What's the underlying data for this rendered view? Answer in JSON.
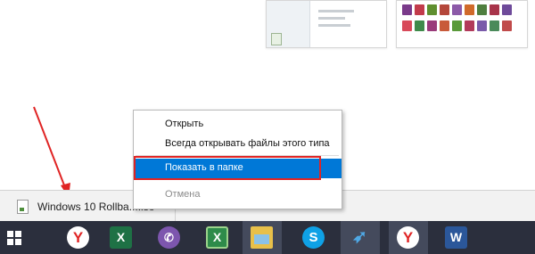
{
  "download_bar": {
    "filename": "Windows 10 Rollba....iso",
    "close_symbol": "×"
  },
  "context_menu": {
    "open": "Открыть",
    "always_open": "Всегда открывать файлы этого типа",
    "show_in_folder": "Показать в папке",
    "cancel": "Отмена",
    "selected_color": "#0078d7"
  },
  "annotation": {
    "color": "#e02424"
  },
  "taskbar": {
    "items": [
      {
        "icon": "windows-start-icon"
      },
      {
        "icon": "yandex-browser-icon",
        "glyph": "Y"
      },
      {
        "icon": "excel-icon",
        "glyph": "X"
      },
      {
        "icon": "viber-icon",
        "glyph": "✆"
      },
      {
        "icon": "spreadsheet-icon",
        "glyph": "X"
      },
      {
        "icon": "file-explorer-icon"
      },
      {
        "icon": "skype-icon",
        "glyph": "S"
      },
      {
        "icon": "bird-app-icon",
        "glyph": "➶"
      },
      {
        "icon": "yandex-browser-user-icon",
        "glyph": "Y"
      },
      {
        "icon": "word-icon",
        "glyph": "W"
      }
    ]
  }
}
